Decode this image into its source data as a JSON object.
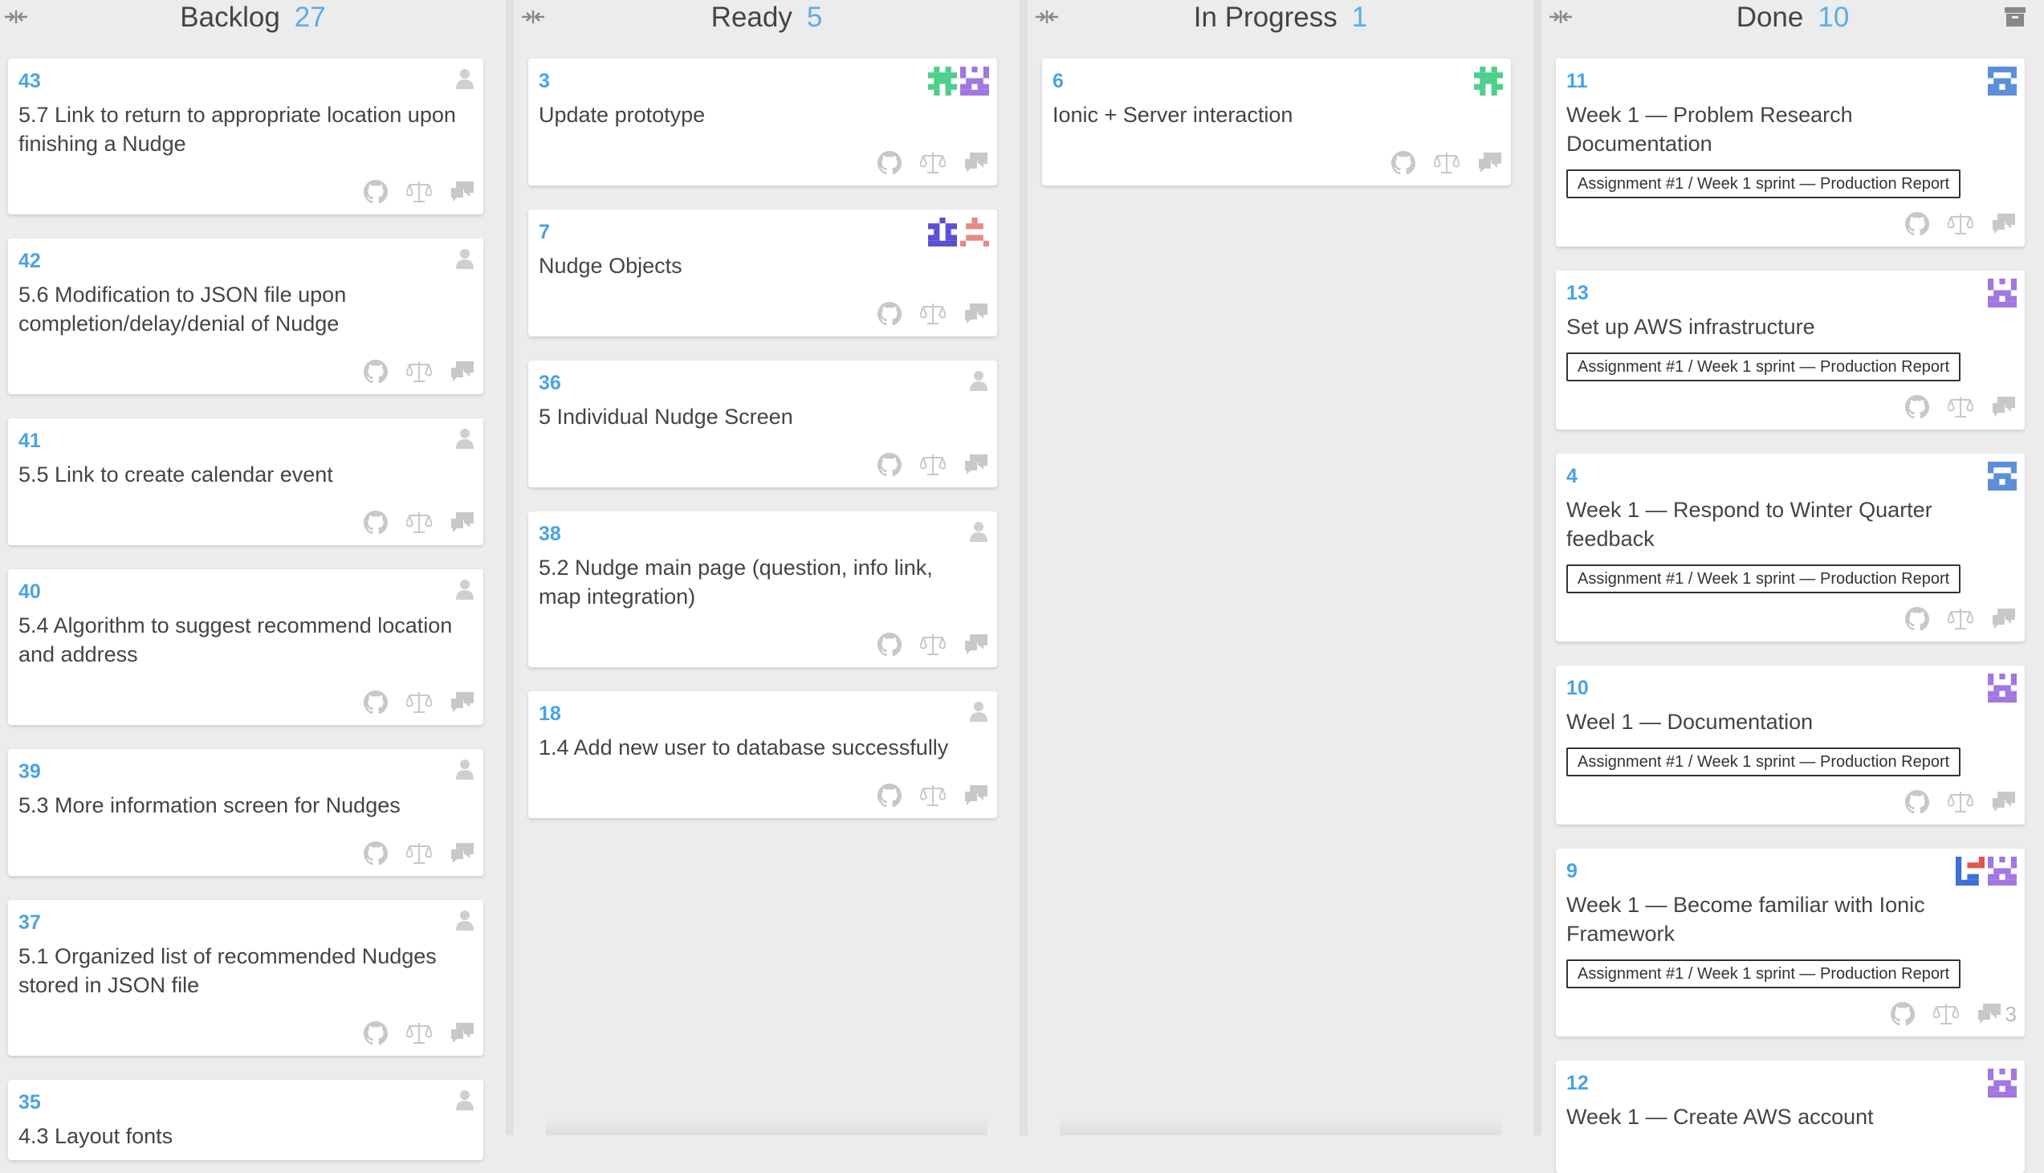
{
  "board": {
    "columns": [
      {
        "name": "Backlog",
        "count": "27",
        "cards": [
          {
            "number": "43",
            "title": "5.7 Link to return to appropriate location upon finishing a Nudge"
          },
          {
            "number": "42",
            "title": "5.6 Modification to JSON file upon completion/delay/denial of Nudge"
          },
          {
            "number": "41",
            "title": "5.5 Link to create calendar event"
          },
          {
            "number": "40",
            "title": "5.4 Algorithm to suggest recommend location and address"
          },
          {
            "number": "39",
            "title": "5.3 More information screen for Nudges"
          },
          {
            "number": "37",
            "title": "5.1 Organized list of recommended Nudges stored in JSON file"
          },
          {
            "number": "35",
            "title": "4.3 Layout fonts"
          }
        ]
      },
      {
        "name": "Ready",
        "count": "5",
        "cards": [
          {
            "number": "3",
            "title": "Update prototype"
          },
          {
            "number": "7",
            "title": "Nudge Objects"
          },
          {
            "number": "36",
            "title": "5 Individual Nudge Screen"
          },
          {
            "number": "38",
            "title": "5.2 Nudge main page (question, info link, map integration)"
          },
          {
            "number": "18",
            "title": "1.4 Add new user to database successfully"
          }
        ]
      },
      {
        "name": "In Progress",
        "count": "1",
        "cards": [
          {
            "number": "6",
            "title": "Ionic + Server interaction"
          }
        ]
      },
      {
        "name": "Done",
        "count": "10",
        "cards": [
          {
            "number": "11",
            "title": "Week 1 — Problem Research Documentation",
            "label": "Assignment #1 / Week 1 sprint — Production Report"
          },
          {
            "number": "13",
            "title": "Set up AWS infrastructure",
            "label": "Assignment #1 / Week 1 sprint — Production Report"
          },
          {
            "number": "4",
            "title": "Week 1 — Respond to Winter Quarter feedback",
            "label": "Assignment #1 / Week 1 sprint — Production Report"
          },
          {
            "number": "10",
            "title": "Weel 1 — Documentation",
            "label": "Assignment #1 / Week 1 sprint — Production Report"
          },
          {
            "number": "9",
            "title": "Week 1 — Become familiar with Ionic Framework",
            "label": "Assignment #1 / Week 1 sprint — Production Report",
            "comments": "3"
          },
          {
            "number": "12",
            "title": "Week 1 — Create AWS account"
          }
        ]
      }
    ]
  },
  "colors": {
    "background": "#ececec",
    "card": "#ffffff",
    "accent": "#4aa3e3",
    "text": "#444444",
    "icon_muted": "#c8c8c8"
  },
  "icons": [
    "collapse-icon",
    "archive-icon",
    "user-icon",
    "github-icon",
    "scale-icon",
    "comment-icon",
    "identicon-avatar"
  ]
}
